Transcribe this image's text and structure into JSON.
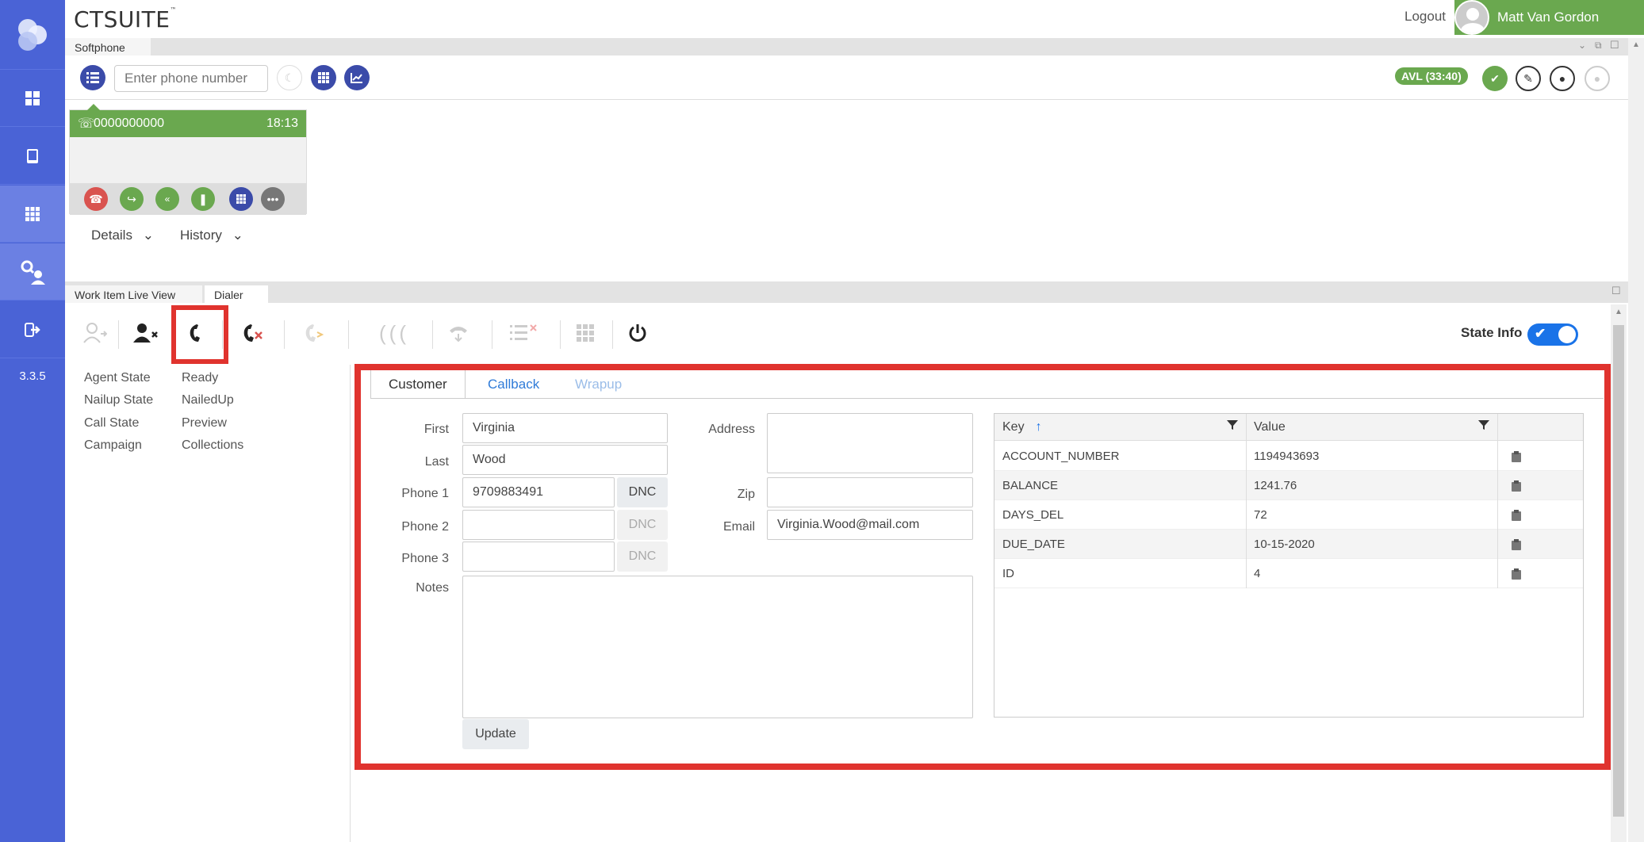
{
  "app": {
    "brand": "CTSUITE",
    "brand_tm": "™",
    "version": "3.3.5"
  },
  "header": {
    "logout": "Logout",
    "user_name": "Matt Van Gordon"
  },
  "sidebar": {
    "items": [
      {
        "icon": "dashboard-icon"
      },
      {
        "icon": "book-icon"
      },
      {
        "icon": "grid-icon"
      },
      {
        "icon": "user-search-icon"
      },
      {
        "icon": "sign-out-icon"
      }
    ]
  },
  "softphone": {
    "tab_label": "Softphone",
    "phone_placeholder": "Enter phone number",
    "avl_status": "AVL (33:40)",
    "call": {
      "number": "0000000000",
      "time": "18:13"
    },
    "details_label": "Details",
    "history_label": "History"
  },
  "bottom_tabs": {
    "work_item": "Work Item Live View",
    "dialer": "Dialer"
  },
  "dialer": {
    "state_info_label": "State Info",
    "state_info_on": true,
    "info": [
      {
        "label": "Agent State",
        "value": "Ready"
      },
      {
        "label": "Nailup State",
        "value": "NailedUp"
      },
      {
        "label": "Call State",
        "value": "Preview"
      },
      {
        "label": "Campaign",
        "value": "Collections"
      }
    ]
  },
  "form": {
    "tabs": {
      "customer": "Customer",
      "callback": "Callback",
      "wrapup": "Wrapup"
    },
    "labels": {
      "first": "First",
      "last": "Last",
      "phone1": "Phone 1",
      "phone2": "Phone 2",
      "phone3": "Phone 3",
      "notes": "Notes",
      "address": "Address",
      "zip": "Zip",
      "email": "Email"
    },
    "values": {
      "first": "Virginia",
      "last": "Wood",
      "phone1": "9709883491",
      "phone2": "",
      "phone3": "",
      "address": "",
      "zip": "",
      "email": "Virginia.Wood@mail.com",
      "notes": ""
    },
    "dnc_label": "DNC",
    "update_label": "Update"
  },
  "kv_grid": {
    "key_header": "Key",
    "value_header": "Value",
    "rows": [
      {
        "key": "ACCOUNT_NUMBER",
        "value": "1194943693"
      },
      {
        "key": "BALANCE",
        "value": "1241.76"
      },
      {
        "key": "DAYS_DEL",
        "value": "72"
      },
      {
        "key": "DUE_DATE",
        "value": "10-15-2020"
      },
      {
        "key": "ID",
        "value": "4"
      }
    ]
  },
  "colors": {
    "sidebar": "#4a63d6",
    "accent_green": "#6aa84f",
    "highlight_red": "#e0332e",
    "link_blue": "#2f7bd8"
  }
}
